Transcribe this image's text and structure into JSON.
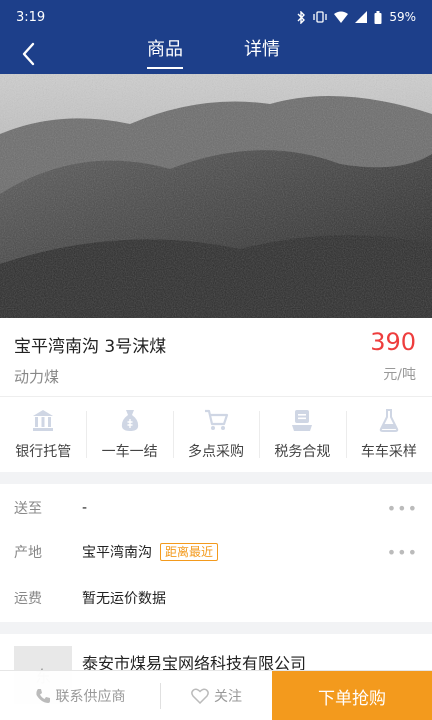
{
  "status_bar": {
    "time": "3:19",
    "battery": "59%"
  },
  "nav": {
    "tabs": [
      {
        "label": "商品",
        "active": true
      },
      {
        "label": "详情",
        "active": false
      }
    ]
  },
  "product": {
    "name": "宝平湾南沟 3号沫煤",
    "category": "动力煤",
    "price": "390",
    "unit": "元/吨",
    "price_color": "#ee3d3d"
  },
  "features": [
    {
      "label": "银行托管",
      "icon": "bank-icon"
    },
    {
      "label": "一车一结",
      "icon": "money-bag-icon"
    },
    {
      "label": "多点采购",
      "icon": "cart-icon"
    },
    {
      "label": "税务合规",
      "icon": "tax-icon"
    },
    {
      "label": "车车采样",
      "icon": "flask-icon"
    }
  ],
  "info": {
    "destination": {
      "label": "送至",
      "value": "-"
    },
    "origin": {
      "label": "产地",
      "value": "宝平湾南沟",
      "badge": "距离最近"
    },
    "freight": {
      "label": "运费",
      "value": "暂无运价数据"
    }
  },
  "supplier": {
    "logo_text": "东",
    "name": "泰安市煤易宝网络科技有限公司"
  },
  "bottom_bar": {
    "contact_label": "联系供应商",
    "favorite_label": "关注",
    "order_label": "下单抢购"
  },
  "colors": {
    "header": "#1d3f8a",
    "accent": "#f39a1d"
  }
}
